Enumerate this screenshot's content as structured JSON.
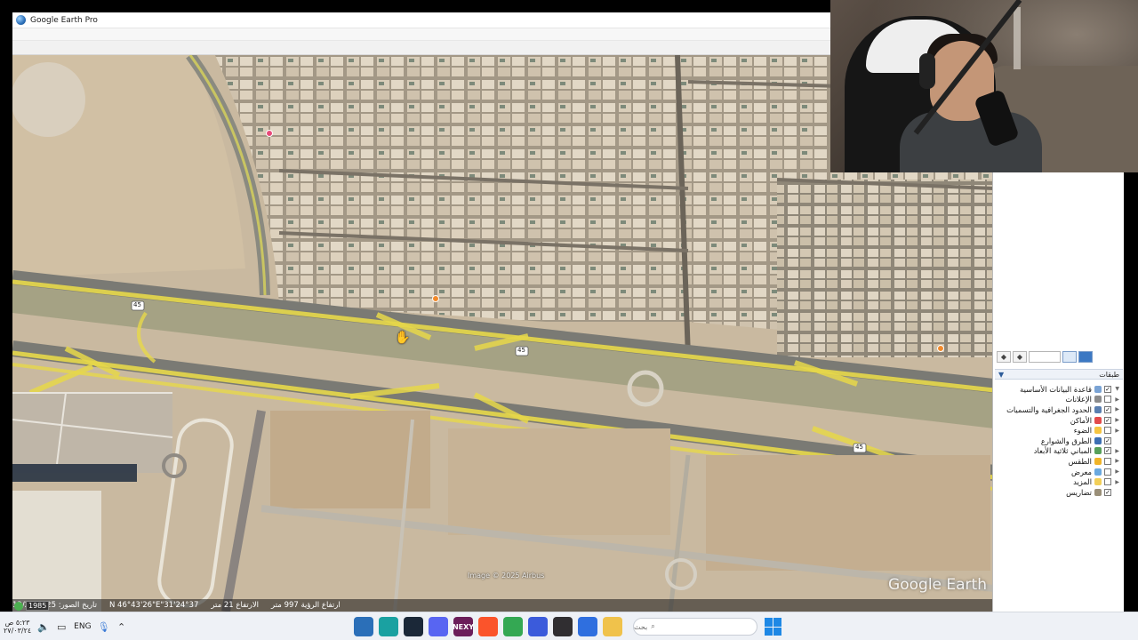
{
  "window": {
    "title": "Google Earth Pro"
  },
  "toolbar": {
    "buttons": [
      "hide-sidebar",
      "placemark",
      "polygon",
      "path",
      "image-overlay",
      "record-tour",
      "historical-imagery",
      "sun",
      "planets",
      "ruler",
      "email",
      "print",
      "save-image",
      "view-in-maps"
    ]
  },
  "map": {
    "road_labels": [
      "45",
      "45",
      "45"
    ],
    "imagery_credit": "Image © 2025 Airbus",
    "watermark": "Google Earth",
    "year": "1985",
    "status": {
      "imagery_date": "تاريخ الصور: 12/22/2025",
      "coords": "24°37'31\"N 46°43'26\"E",
      "elevation": "الارتفاع 21 متر",
      "eye_alt": "ارتفاع الرؤية 997 متر"
    }
  },
  "sidebar": {
    "search_placeholder": "",
    "layers_title": "طبقات",
    "layers": [
      {
        "label": "قاعدة البيانات الأساسية",
        "checked": true,
        "color": "#7aa3d4",
        "expand": "▼"
      },
      {
        "label": "الإعلانات",
        "checked": false,
        "color": "#8b8b8b",
        "expand": "▶"
      },
      {
        "label": "الحدود الجغرافية والتسميات",
        "checked": true,
        "color": "#5a7fb0",
        "expand": "▶"
      },
      {
        "label": "الأماكن",
        "checked": true,
        "color": "#e34b4b",
        "expand": "▶"
      },
      {
        "label": "الضوء",
        "checked": false,
        "color": "#f5c542",
        "expand": "▶"
      },
      {
        "label": "الطرق والشوارع",
        "checked": true,
        "color": "#3c6fb3",
        "expand": ""
      },
      {
        "label": "المباني ثلاثية الأبعاد",
        "checked": true,
        "color": "#57a05a",
        "expand": "▶"
      },
      {
        "label": "الطقس",
        "checked": false,
        "color": "#f0b429",
        "expand": "▶"
      },
      {
        "label": "معرض",
        "checked": false,
        "color": "#6aa9e0",
        "expand": "▶"
      },
      {
        "label": "المزيد",
        "checked": false,
        "color": "#f2cf58",
        "expand": "▶"
      },
      {
        "label": "تضاريس",
        "checked": true,
        "color": "#9a8f78",
        "expand": ""
      }
    ]
  },
  "taskbar": {
    "time": "٥:٢٣ ص",
    "date": "٢٧/٠٣/٢٤",
    "language": "ENG",
    "search_placeholder": "بحث",
    "apps": [
      {
        "name": "google-earth",
        "color": "#2b6fb8",
        "label": ""
      },
      {
        "name": "vpn",
        "color": "#1aa1a1",
        "label": ""
      },
      {
        "name": "steam",
        "color": "#1b2838",
        "label": ""
      },
      {
        "name": "discord",
        "color": "#5865f2",
        "label": ""
      },
      {
        "name": "nexy",
        "color": "#6b1e5a",
        "label": "NEXY"
      },
      {
        "name": "brave",
        "color": "#fb542b",
        "label": ""
      },
      {
        "name": "chrome",
        "color": "#34a853",
        "label": ""
      },
      {
        "name": "app-blue",
        "color": "#3b5bdb",
        "label": ""
      },
      {
        "name": "obs",
        "color": "#302e31",
        "label": ""
      },
      {
        "name": "photos",
        "color": "#2f6fdf",
        "label": ""
      },
      {
        "name": "file-explorer",
        "color": "#f0c24b",
        "label": ""
      }
    ]
  }
}
